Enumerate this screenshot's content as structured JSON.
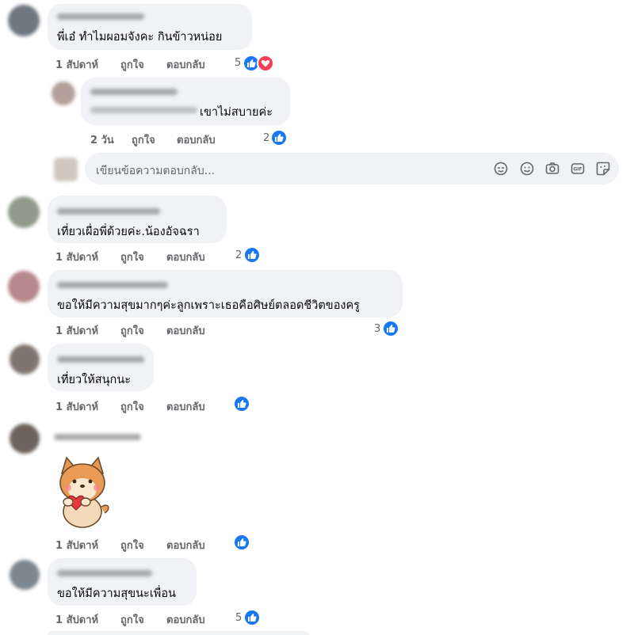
{
  "comments": [
    {
      "text": "พี่เอ๋ ทำไมผอมจังคะ กินข้าวหน่อย",
      "time": "1 สัปดาห์",
      "like": "ถูกใจ",
      "reply": "ตอบกลับ",
      "reactions": "5"
    },
    {
      "text_visible": "เขาไม่สบายค่ะ",
      "time": "2 วัน",
      "like": "ถูกใจ",
      "reply": "ตอบกลับ",
      "reactions": "2"
    },
    {
      "text": "เที่ยวเผื่อพี่ด้วยค่ะ.น้องอัจฉรา",
      "time": "1 สัปดาห์",
      "like": "ถูกใจ",
      "reply": "ตอบกลับ",
      "reactions": "2"
    },
    {
      "text": "ขอให้มีความสุขมากๆค่ะลูกเพราะเธอคือศิษย์ตลอดชีวิตของครู",
      "time": "1 สัปดาห์",
      "like": "ถูกใจ",
      "reply": "ตอบกลับ",
      "reactions": "3"
    },
    {
      "text": "เที่ยวให้สนุกนะ",
      "time": "1 สัปดาห์",
      "like": "ถูกใจ",
      "reply": "ตอบกลับ",
      "reactions": ""
    },
    {
      "sticker": "shiba-dog-heart-sticker",
      "time": "1 สัปดาห์",
      "like": "ถูกใจ",
      "reply": "ตอบกลับ",
      "reactions": ""
    },
    {
      "text": "ขอให้มีความสุขนะเพื่อน",
      "time": "1 สัปดาห์",
      "like": "ถูกใจ",
      "reply": "ตอบกลับ",
      "reactions": "5"
    }
  ],
  "reply_box": {
    "placeholder": "เขียนข้อความตอบกลับ..."
  },
  "icons": [
    "sticker-face-icon",
    "emoji-icon",
    "camera-icon",
    "gif-icon",
    "sticker-icon"
  ],
  "colors": {
    "like_blue": "#1877f2",
    "love_red": "#f33e58",
    "bubble_bg": "#f0f2f5",
    "meta_gray": "#65676b"
  }
}
